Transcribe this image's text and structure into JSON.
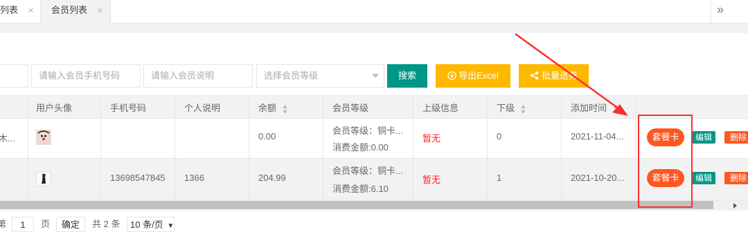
{
  "tabs": [
    {
      "label": "列表",
      "close": "✕"
    },
    {
      "label": "会员列表",
      "close": "✕",
      "active": true
    }
  ],
  "tab_more_icon": "»",
  "search": {
    "field1_value": "",
    "phone_placeholder": "请输入会员手机号码",
    "desc_placeholder": "请输入会员说明",
    "level_placeholder": "选择会员等级",
    "search_label": "搜索",
    "export_label": "导出Excel",
    "batch_label": "批量送券"
  },
  "table": {
    "headers": {
      "avatar": "用户头像",
      "phone": "手机号码",
      "desc": "个人说明",
      "balance": "余额",
      "level": "会员等级",
      "parent": "上级信息",
      "sub": "下级",
      "added": "添加时间"
    },
    "rows": [
      {
        "name": "木...",
        "phone": "",
        "desc": "",
        "balance": "0.00",
        "level_line1": "会员等级：铜卡...",
        "level_line2": "消费金额:0.00",
        "parent": "暂无",
        "sub": "0",
        "added": "2021-11-04...",
        "pkg_btn": "套餐卡",
        "edit_btn": "编辑",
        "del_btn": "删除"
      },
      {
        "name": "",
        "phone": "13698547845",
        "desc": "1366",
        "balance": "204.99",
        "level_line1": "会员等级：铜卡...",
        "level_line2": "消费金额:6.10",
        "parent": "暂无",
        "sub": "1",
        "added": "2021-10-20...",
        "pkg_btn": "套餐卡",
        "edit_btn": "编辑",
        "del_btn": "删除"
      }
    ]
  },
  "pager": {
    "prefix": "第",
    "page_value": "1",
    "page_unit": "页",
    "confirm": "确定",
    "total": "共 2 条",
    "per_page": "10 条/页",
    "per_page_arrow": "▼"
  },
  "colors": {
    "teal": "#009688",
    "yellow": "#ffb800",
    "orange": "#ff5722",
    "annotation": "#ff2d2d"
  }
}
